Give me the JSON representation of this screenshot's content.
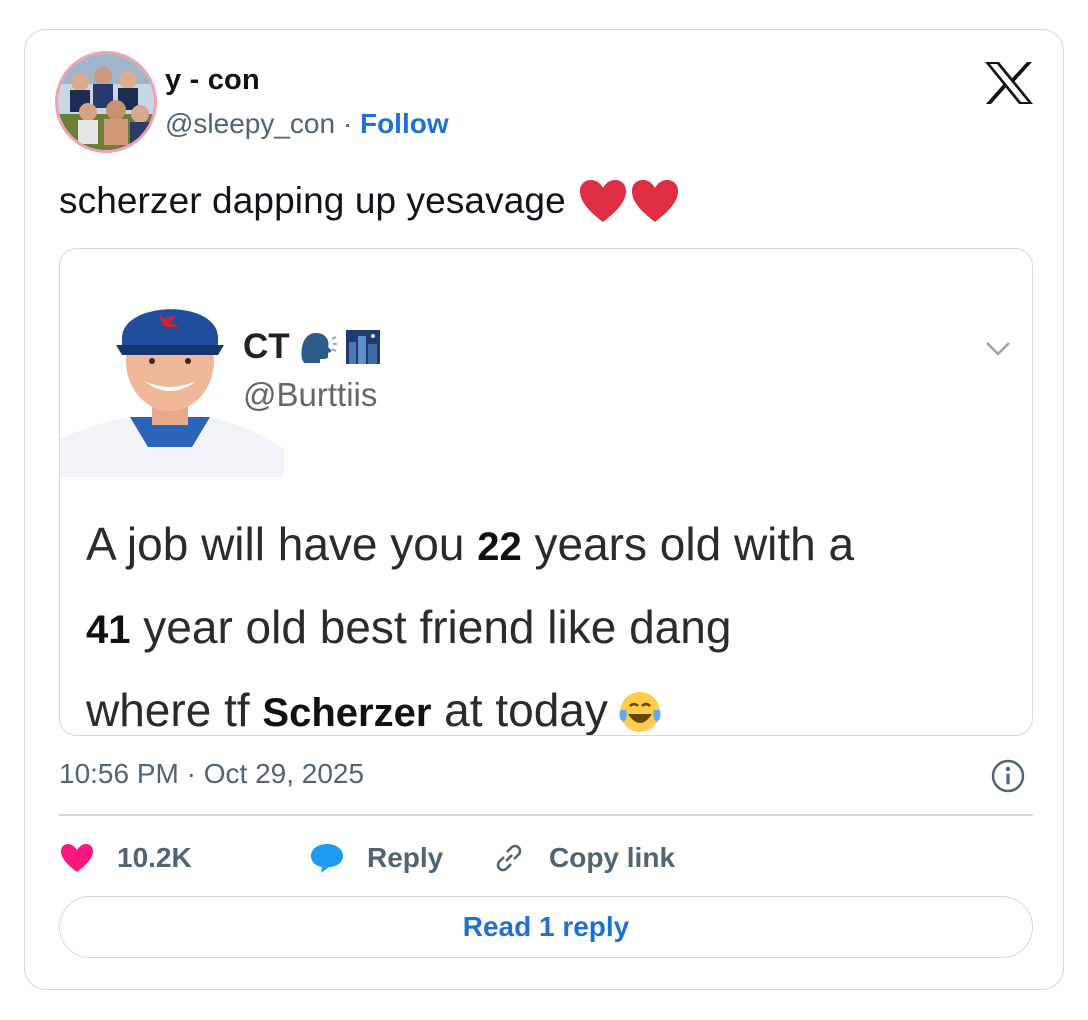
{
  "author": {
    "name": "y - con",
    "handle": "@sleepy_con",
    "separator": "·",
    "follow_label": "Follow"
  },
  "tweet": {
    "text": "scherzer dapping up yesavage",
    "emoji": [
      "red-heart-emoji",
      "red-heart-emoji"
    ]
  },
  "quoted": {
    "name": "CT",
    "name_emojis": [
      "speaking-head-emoji",
      "city-night-emoji"
    ],
    "handle": "@Burttiis",
    "lines": [
      {
        "pre": "A job will have you ",
        "num": "22",
        "post": " years old with a"
      },
      {
        "pre": "",
        "num": "41",
        "post": " year old best friend like dang"
      },
      {
        "pre": "where tf ",
        "num": "Scherzer",
        "post": " at today",
        "emoji": "tears-of-joy-emoji"
      }
    ]
  },
  "meta": {
    "timestamp": "10:56 PM · Oct 29, 2025"
  },
  "actions": {
    "likes": "10.2K",
    "reply_label": "Reply",
    "copy_label": "Copy link"
  },
  "read_reply_label": "Read 1 reply",
  "colors": {
    "accent": "#1d70d6",
    "like": "#f91880",
    "reply": "#1d9bf0",
    "muted": "#536471",
    "border": "#cfd9de"
  }
}
